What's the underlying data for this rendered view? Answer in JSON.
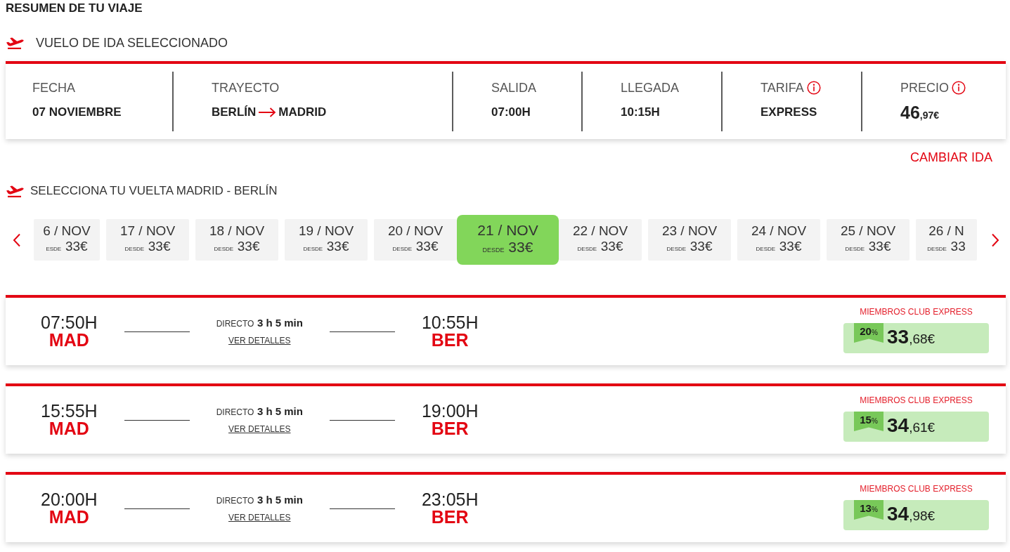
{
  "summary_title": "RESUMEN DE TU VIAJE",
  "outbound": {
    "heading": "VUELO DE IDA SELECCIONADO",
    "fields": [
      {
        "kind": "text",
        "label": "FECHA",
        "value": "07 NOVIEMBRE",
        "info": false
      },
      {
        "kind": "route",
        "label": "TRAYECTO",
        "origin": "BERLÍN",
        "destination": "MADRID",
        "info": false
      },
      {
        "kind": "text",
        "label": "SALIDA",
        "value": "07:00H",
        "info": false
      },
      {
        "kind": "text",
        "label": "LLEGADA",
        "value": "10:15H",
        "info": false
      },
      {
        "kind": "text",
        "label": "TARIFA",
        "value": "EXPRESS",
        "info": true
      },
      {
        "kind": "price",
        "label": "PRECIO",
        "amount": "46",
        "decimals": ",97€",
        "info": true
      }
    ],
    "change_link": "CAMBIAR IDA"
  },
  "return_flight": {
    "heading": "SELECCIONA TU VUELTA MADRID - BERLÍN",
    "dates": [
      {
        "date": "6 / NOV",
        "from_label": "ESDE",
        "price": "33€",
        "selected": false
      },
      {
        "date": "17 / NOV",
        "from_label": "DESDE",
        "price": "33€",
        "selected": false
      },
      {
        "date": "18 / NOV",
        "from_label": "DESDE",
        "price": "33€",
        "selected": false
      },
      {
        "date": "19 / NOV",
        "from_label": "DESDE",
        "price": "33€",
        "selected": false
      },
      {
        "date": "20 / NOV",
        "from_label": "DESDE",
        "price": "33€",
        "selected": false
      },
      {
        "date": "21 / NOV",
        "from_label": "DESDE",
        "price": "33€",
        "selected": true
      },
      {
        "date": "22 / NOV",
        "from_label": "DESDE",
        "price": "33€",
        "selected": false
      },
      {
        "date": "23 / NOV",
        "from_label": "DESDE",
        "price": "33€",
        "selected": false
      },
      {
        "date": "24 / NOV",
        "from_label": "DESDE",
        "price": "33€",
        "selected": false
      },
      {
        "date": "25 / NOV",
        "from_label": "DESDE",
        "price": "33€",
        "selected": false
      },
      {
        "date": "26 / N",
        "from_label": "DESDE",
        "price": "33",
        "selected": false
      }
    ],
    "flights": [
      {
        "departure_time": "07:50H",
        "origin": "MAD",
        "stops": "DIRECTO",
        "duration": "3 h 5 min",
        "details_link": "VER DETALLES",
        "arrival_time": "10:55H",
        "destination": "BER",
        "promo_label": "MIEMBROS CLUB EXPRESS",
        "discount": "20",
        "discount_unit": "%",
        "amount": "33",
        "decimals": ",68€"
      },
      {
        "departure_time": "15:55H",
        "origin": "MAD",
        "stops": "DIRECTO",
        "duration": "3 h 5 min",
        "details_link": "VER DETALLES",
        "arrival_time": "19:00H",
        "destination": "BER",
        "promo_label": "MIEMBROS CLUB EXPRESS",
        "discount": "15",
        "discount_unit": "%",
        "amount": "34",
        "decimals": ",61€"
      },
      {
        "departure_time": "20:00H",
        "origin": "MAD",
        "stops": "DIRECTO",
        "duration": "3 h 5 min",
        "details_link": "VER DETALLES",
        "arrival_time": "23:05H",
        "destination": "BER",
        "promo_label": "MIEMBROS CLUB EXPRESS",
        "discount": "13",
        "discount_unit": "%",
        "amount": "34",
        "decimals": ",98€"
      }
    ]
  }
}
